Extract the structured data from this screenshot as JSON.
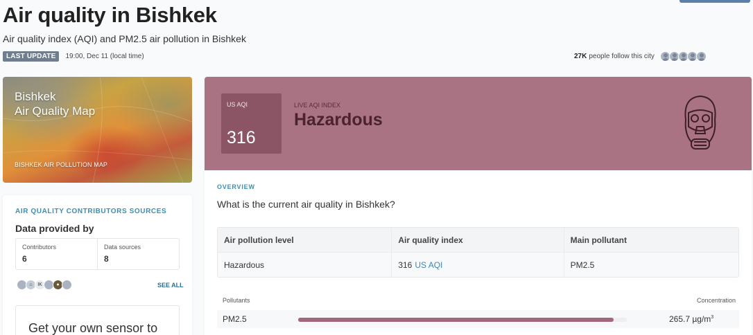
{
  "header": {
    "title": "Air quality in Bishkek",
    "subtitle": "Air quality index (AQI) and PM2.5 air pollution in Bishkek",
    "last_update_badge": "LAST UPDATE",
    "last_update_time": "19:00, Dec 11 (local time)",
    "followers_count": "27K",
    "followers_text": "people follow this city"
  },
  "map_card": {
    "title_line1": "Bishkek",
    "title_line2": "Air Quality Map",
    "caption": "BISHKEK AIR POLLUTION MAP"
  },
  "contributors": {
    "section_label": "AIR QUALITY CONTRIBUTORS SOURCES",
    "heading": "Data provided by",
    "contributors_label": "Contributors",
    "contributors_value": "6",
    "sources_label": "Data sources",
    "sources_value": "8",
    "avatar_initials": "IK",
    "see_all": "SEE ALL",
    "sensor_cta": "Get your own sensor to"
  },
  "aqi": {
    "box_label": "US AQI",
    "value": "316",
    "live_label": "LIVE AQI INDEX",
    "status": "Hazardous",
    "banner_color": "#a97383",
    "box_color": "#8b5566"
  },
  "overview": {
    "label": "OVERVIEW",
    "question": "What is the current air quality in Bishkek?",
    "table_headers": [
      "Air pollution level",
      "Air quality index",
      "Main pollutant"
    ],
    "row": {
      "level": "Hazardous",
      "aqi_value": "316",
      "aqi_unit": "US AQI",
      "pollutant": "PM2.5"
    }
  },
  "pollutants": {
    "label": "Pollutants",
    "concentration_label": "Concentration",
    "items": [
      {
        "name": "PM2.5",
        "value": "265.7 µg/m",
        "unit_sup": "3",
        "bar_fraction": 0.96
      }
    ]
  }
}
